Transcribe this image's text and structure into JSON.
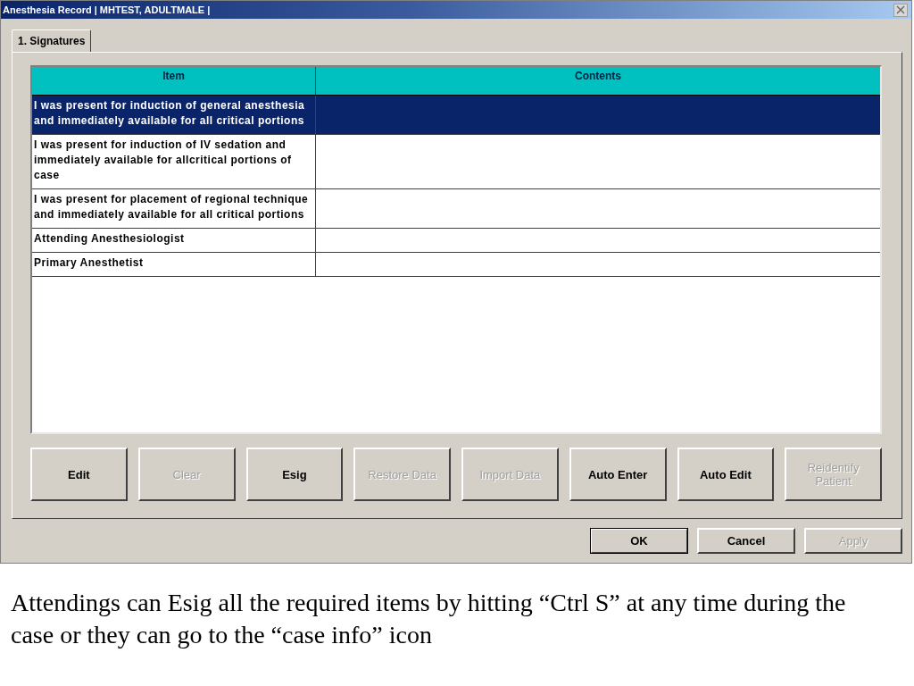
{
  "window": {
    "title": "Anesthesia Record | MHTEST, ADULTMALE |"
  },
  "tabs": [
    {
      "label": "1. Signatures",
      "selected": true
    }
  ],
  "table": {
    "columns": [
      "Item",
      "Contents"
    ],
    "rows": [
      {
        "item": "I was present for induction of general anesthesia and immediately available for all critical portions",
        "selected": true
      },
      {
        "item": "I was present for induction of IV sedation and immediately available for allcritical portions of case",
        "selected": false
      },
      {
        "item": "I was present for placement of regional technique and immediately available for all critical portions",
        "selected": false
      },
      {
        "item": "Attending Anesthesiologist",
        "selected": false
      },
      {
        "item": "Primary Anesthetist",
        "selected": false
      }
    ]
  },
  "action_buttons": [
    {
      "label": "Edit",
      "disabled": false
    },
    {
      "label": "Clear",
      "disabled": true
    },
    {
      "label": "Esig",
      "disabled": false
    },
    {
      "label": "Restore Data",
      "disabled": true
    },
    {
      "label": "Import Data",
      "disabled": true
    },
    {
      "label": "Auto Enter",
      "disabled": false
    },
    {
      "label": "Auto Edit",
      "disabled": false
    },
    {
      "label": "Reidentify Patient",
      "disabled": true
    }
  ],
  "dialog_buttons": [
    {
      "label": "OK",
      "default": true,
      "disabled": false
    },
    {
      "label": "Cancel",
      "default": false,
      "disabled": false
    },
    {
      "label": "Apply",
      "default": false,
      "disabled": true
    }
  ],
  "caption": "Attendings can Esig all the required items by hitting “Ctrl S” at any time during the case or they can go to the “case info” icon"
}
